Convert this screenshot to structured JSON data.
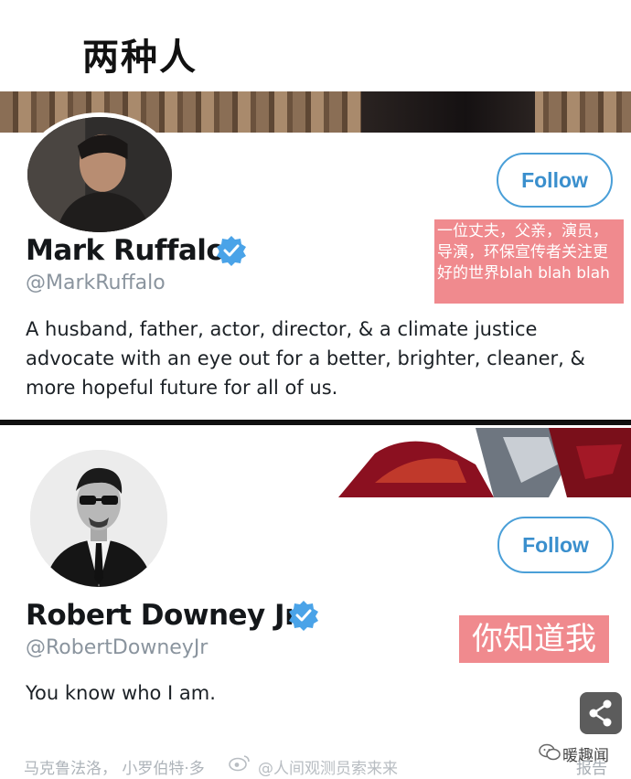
{
  "page_title": "两种人",
  "profiles": [
    {
      "display_name": "Mark Ruffalo",
      "handle": "@MarkRuffalo",
      "bio": "A husband, father, actor, director, & a climate justice advocate with an eye out for a better, brighter, cleaner, & more hopeful future for all of us.",
      "follow_label": "Follow",
      "verified": true,
      "annotation": "一位丈夫，父亲，演员，导演，环保宣传者关注更好的世界blah blah blah"
    },
    {
      "display_name": "Robert Downey Jr",
      "handle": "@RobertDowneyJr",
      "bio": "You know who I am.",
      "follow_label": "Follow",
      "verified": true,
      "annotation": "你知道我"
    }
  ],
  "footer": {
    "caption": "马克鲁法洛，  小罗伯特·多",
    "weibo_watermark": "@人间观测员索来来",
    "brand": "暖趣闻",
    "report_label": "报告"
  },
  "icons": {
    "share": "share-icon",
    "verified": "verified-badge-icon",
    "weibo": "weibo-icon",
    "brand": "wechat-icon"
  },
  "colors": {
    "follow_blue": "#3a8fcd",
    "annotation_pink": "#f08a8e",
    "verified_blue": "#4aa3e8"
  }
}
